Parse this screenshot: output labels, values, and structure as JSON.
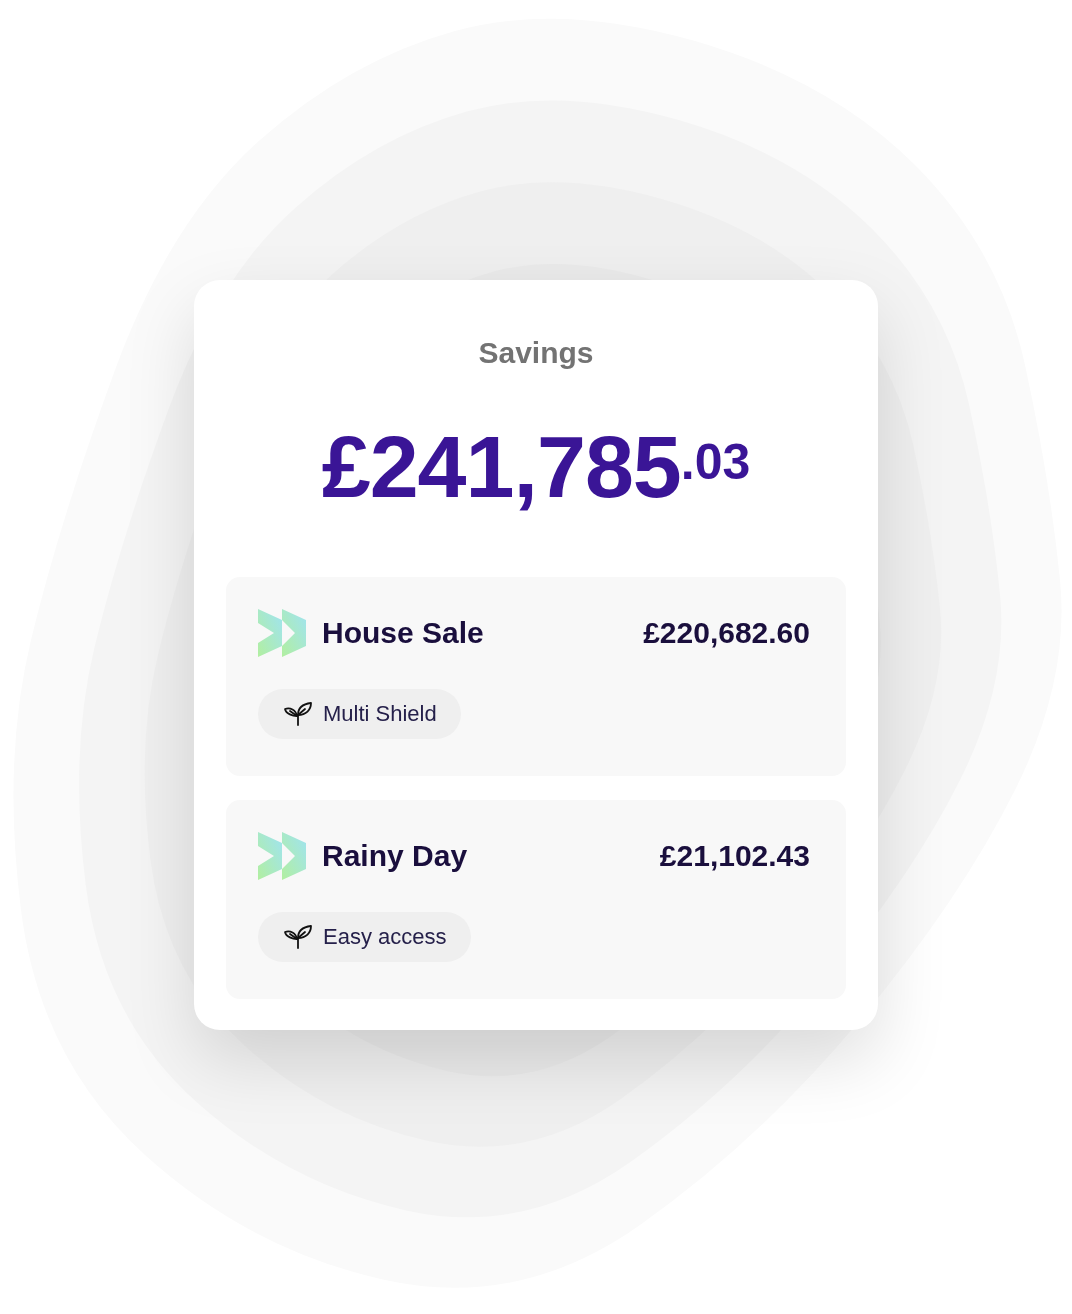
{
  "card": {
    "title": "Savings",
    "total": "£241,785$^{.03}$"
  },
  "accounts": [
    {
      "name": "House Sale",
      "balance": "£220,682.60",
      "tag": "Multi Shield"
    },
    {
      "name": "Rainy Day",
      "balance": "£21,102.43",
      "tag": "Easy access"
    }
  ]
}
